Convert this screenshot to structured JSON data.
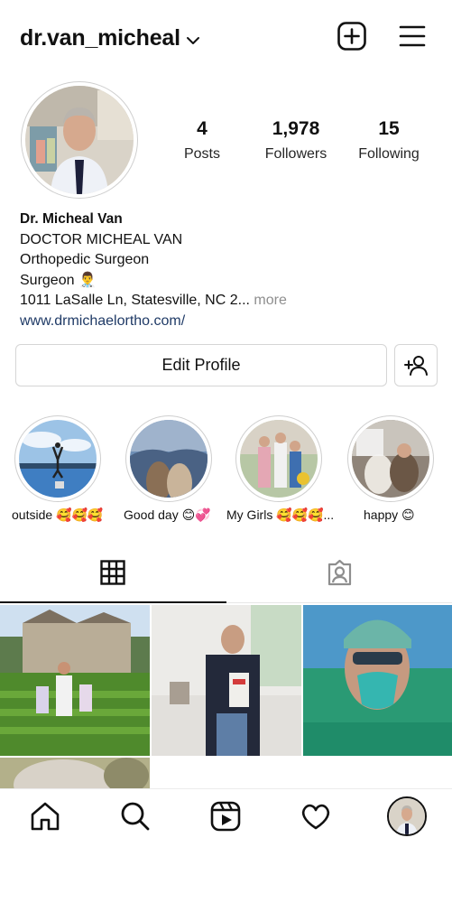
{
  "header": {
    "username": "dr.van_micheal",
    "icons": [
      "chevron-down-icon",
      "new-post-icon",
      "menu-icon"
    ]
  },
  "stats": [
    {
      "value": "4",
      "label": "Posts"
    },
    {
      "value": "1,978",
      "label": "Followers"
    },
    {
      "value": "15",
      "label": "Following"
    }
  ],
  "bio": {
    "name": "Dr. Micheal Van",
    "line1": "DOCTOR MICHEAL VAN",
    "line2": "Orthopedic Surgeon",
    "line3": "Surgeon 👨‍⚕️",
    "address": "1011 LaSalle Ln, Statesville, NC 2...",
    "more": " more",
    "website": "www.drmichaelortho.com/"
  },
  "actions": {
    "edit_profile": "Edit Profile",
    "add_user_icon": "add-user-icon"
  },
  "highlights": [
    {
      "label": "outside 🥰🥰🥰"
    },
    {
      "label": "Good day 😊💞"
    },
    {
      "label": "My Girls 🥰🥰🥰..."
    },
    {
      "label": "happy 😊"
    }
  ],
  "tabs": [
    "grid-icon",
    "tagged-icon"
  ],
  "nav": [
    "home-icon",
    "search-icon",
    "reels-icon",
    "heart-icon",
    "profile-avatar"
  ],
  "colors": {
    "link": "#1f3a66",
    "muted": "#8e8e8e",
    "border": "#d5d5d5"
  }
}
